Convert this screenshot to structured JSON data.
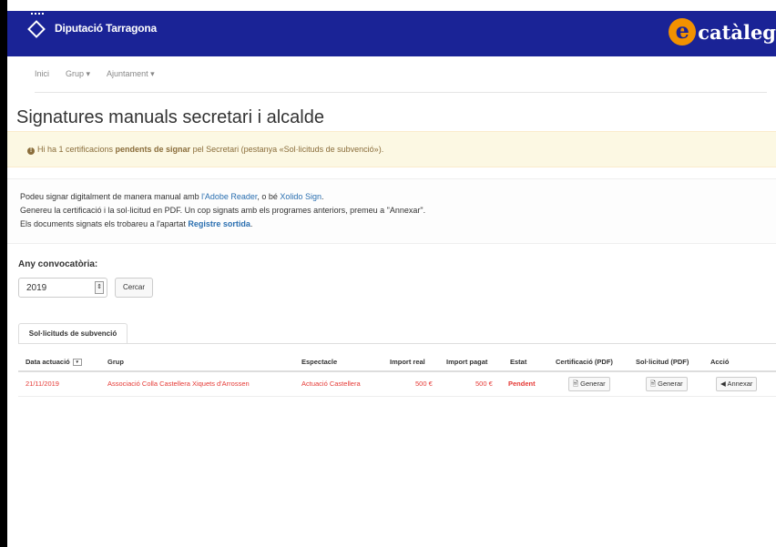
{
  "header": {
    "org": "Diputació Tarragona",
    "brand_e": "e",
    "brand": "catàleg"
  },
  "nav": {
    "items": [
      "Inici",
      "Grup ▾",
      "Ajuntament ▾"
    ]
  },
  "page": {
    "title": "Signatures manuals secretari i alcalde"
  },
  "alert": {
    "pre": "Hi ha 1 certificacions ",
    "bold": "pendents de signar",
    "post": " pel Secretari (pestanya «Sol·licituds de subvenció»)."
  },
  "info": {
    "line1_pre": "Podeu signar digitalment de manera manual amb ",
    "link1": "l'Adobe Reader",
    "line1_mid": ", o bé ",
    "link2": "Xolido Sign",
    "line1_post": ".",
    "line2": "Genereu la certificació i la sol·licitud en PDF. Un cop signats amb els programes anteriors, premeu a \"Annexar\".",
    "line3_pre": "Els documents signats els trobareu a l'apartat ",
    "link3": "Registre sortida",
    "line3_post": "."
  },
  "filter": {
    "label": "Any convocatòria:",
    "year": "2019",
    "button": "Cercar"
  },
  "tabs": [
    "Sol·licituds de subvenció"
  ],
  "table": {
    "headers": [
      "Data actuació",
      "Grup",
      "Espectacle",
      "Import real",
      "Import pagat",
      "Estat",
      "Certificació (PDF)",
      "Sol·licitud (PDF)",
      "Acció"
    ],
    "rows": [
      {
        "date": "21/11/2019",
        "group": "Associació Colla Castellera Xiquets d'Arrossen",
        "show": "Actuació Castellera",
        "import_real": "500 €",
        "import_pagat": "500 €",
        "status": "Pendent",
        "cert_btn": "Generar",
        "sol_btn": "Generar",
        "action_btn": "Annexar"
      }
    ]
  },
  "colors": {
    "header_bg": "#1a2396",
    "brand_orange": "#f29100",
    "alert_bg": "#fcf8e3",
    "pending_red": "#e53935",
    "link_blue": "#2a6fb0"
  }
}
